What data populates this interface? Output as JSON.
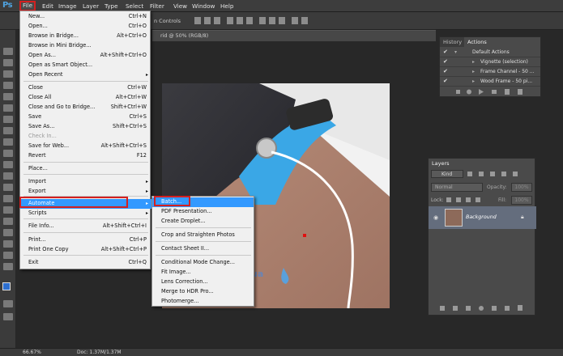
{
  "app": {
    "logo": "Ps"
  },
  "menubar": {
    "items": [
      "File",
      "Edit",
      "Image",
      "Layer",
      "Type",
      "Select",
      "Filter",
      "View",
      "Window",
      "Help"
    ]
  },
  "options_bar": {
    "show_transform_controls": "n Controls"
  },
  "doc_tab": {
    "title": "rid @ 50% (RGB/8)"
  },
  "file_menu": {
    "items": [
      {
        "label": "New...",
        "shortcut": "Ctrl+N"
      },
      {
        "label": "Open...",
        "shortcut": "Ctrl+O"
      },
      {
        "label": "Browse in Bridge...",
        "shortcut": "Alt+Ctrl+O"
      },
      {
        "label": "Browse in Mini Bridge...",
        "shortcut": ""
      },
      {
        "label": "Open As...",
        "shortcut": "Alt+Shift+Ctrl+O"
      },
      {
        "label": "Open as Smart Object...",
        "shortcut": ""
      },
      {
        "label": "Open Recent",
        "shortcut": ""
      },
      {
        "label": "Close",
        "shortcut": "Ctrl+W"
      },
      {
        "label": "Close All",
        "shortcut": "Alt+Ctrl+W"
      },
      {
        "label": "Close and Go to Bridge...",
        "shortcut": "Shift+Ctrl+W"
      },
      {
        "label": "Save",
        "shortcut": "Ctrl+S"
      },
      {
        "label": "Save As...",
        "shortcut": "Shift+Ctrl+S"
      },
      {
        "label": "Check In...",
        "shortcut": ""
      },
      {
        "label": "Save for Web...",
        "shortcut": "Alt+Shift+Ctrl+S"
      },
      {
        "label": "Revert",
        "shortcut": "F12"
      },
      {
        "label": "Place...",
        "shortcut": ""
      },
      {
        "label": "Import",
        "shortcut": ""
      },
      {
        "label": "Export",
        "shortcut": ""
      },
      {
        "label": "Automate",
        "shortcut": ""
      },
      {
        "label": "Scripts",
        "shortcut": ""
      },
      {
        "label": "File Info...",
        "shortcut": "Alt+Shift+Ctrl+I"
      },
      {
        "label": "Print...",
        "shortcut": "Ctrl+P"
      },
      {
        "label": "Print One Copy",
        "shortcut": "Alt+Shift+Ctrl+P"
      },
      {
        "label": "Exit",
        "shortcut": "Ctrl+Q"
      }
    ]
  },
  "automate_submenu": {
    "items": [
      "Batch...",
      "PDF Presentation...",
      "Create Droplet...",
      "Crop and Straighten Photos",
      "Contact Sheet II...",
      "Conditional Mode Change...",
      "Fit Image...",
      "Lens Correction...",
      "Merge to HDR Pro...",
      "Photomerge..."
    ]
  },
  "actions_panel": {
    "tabs": [
      "History",
      "Actions"
    ],
    "rows": [
      "Default Actions",
      "Vignette (selection)",
      "Frame Channel - 50 ...",
      "Wood Frame - 50 pi..."
    ]
  },
  "layers_panel": {
    "tab": "Layers",
    "kind": "Kind",
    "blend_mode": "Normal",
    "opacity_label": "Opacity:",
    "opacity_value": "100%",
    "lock_label": "Lock:",
    "fill_label": "Fill:",
    "fill_value": "100%",
    "layer_name": "Background"
  },
  "canvas": {
    "watermark": "ua"
  },
  "status": {
    "zoom": "66.67%",
    "doc": "Doc: 1.37M/1.37M"
  },
  "colors": {
    "accent": "#3399ff",
    "highlight_box": "#d42020",
    "menu_bg": "#f0f0f0",
    "band": "#3aa7e6"
  }
}
